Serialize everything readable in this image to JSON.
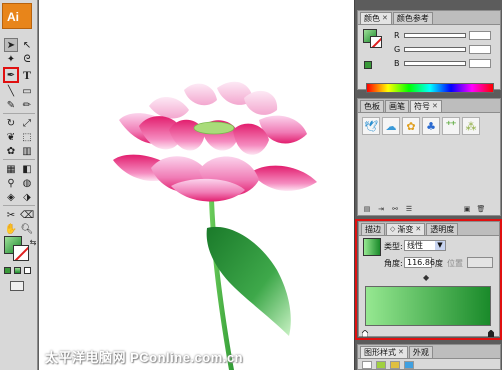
{
  "app": {
    "logo": "Ai"
  },
  "watermark": "太平洋电脑网 PConline.com.cn",
  "colors": {
    "gradient_start": "#96e891",
    "gradient_end": "#1a8a2a",
    "highlight": "#e01010",
    "logo_bg": "#e8851a"
  },
  "color_panel": {
    "tabs": [
      "颜色",
      "颜色参考"
    ],
    "channels": [
      "R",
      "G",
      "B"
    ]
  },
  "swatch_panel": {
    "tabs": [
      "色板",
      "画笔",
      "符号"
    ]
  },
  "gradient_panel": {
    "tabs": [
      "描边",
      "渐变",
      "透明度"
    ],
    "type_label": "类型:",
    "type_value": "线性",
    "angle_label": "角度:",
    "angle_value": "116.86",
    "angle_unit": "度",
    "location_label": "位置"
  },
  "graphic_styles_panel": {
    "tabs": [
      "图形样式",
      "外观"
    ]
  }
}
